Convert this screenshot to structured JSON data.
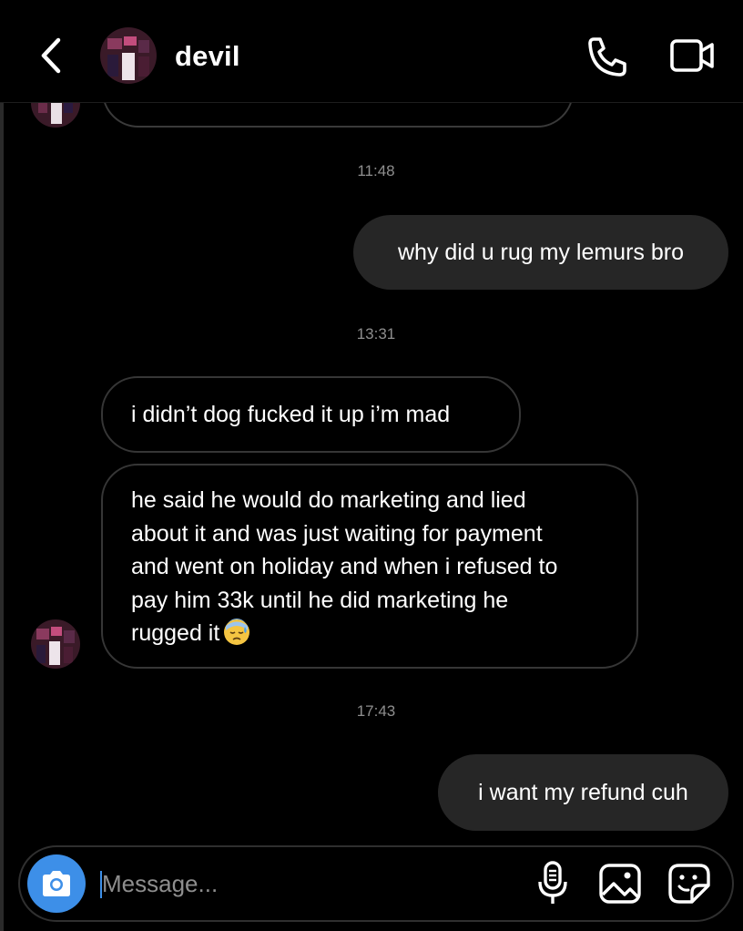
{
  "header": {
    "contact_name": "devil",
    "back_icon": "chevron-left-icon",
    "call_icon": "phone-icon",
    "video_icon": "video-camera-icon"
  },
  "thread": {
    "messages": [
      {
        "kind": "timestamp",
        "text": "11:48"
      },
      {
        "kind": "outgoing",
        "text": "why did u rug my lemurs bro"
      },
      {
        "kind": "timestamp",
        "text": "13:31"
      },
      {
        "kind": "incoming",
        "text": "i didn’t dog fucked it up i’m mad"
      },
      {
        "kind": "incoming",
        "lines": [
          "he said he would do marketing and lied",
          "about it and was just waiting for payment",
          "and went on holiday and when i refused to",
          "pay him 33k until he did marketing he",
          "rugged it"
        ],
        "emoji": "downcast-face-with-sweat-emoji"
      },
      {
        "kind": "timestamp",
        "text": "17:43"
      },
      {
        "kind": "outgoing",
        "text": "i want my refund cuh"
      }
    ]
  },
  "composer": {
    "placeholder": "Message...",
    "value": "",
    "icons": [
      "camera-icon",
      "microphone-icon",
      "gallery-icon",
      "sticker-icon"
    ]
  },
  "colors": {
    "background": "#000000",
    "outgoing_bubble": "#262626",
    "incoming_border": "#363636",
    "timestamp": "#8e8e8e",
    "accent": "#3d8fe8"
  }
}
